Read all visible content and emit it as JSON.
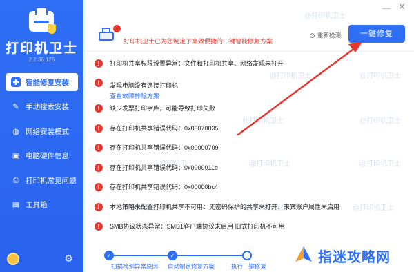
{
  "app": {
    "title": "打印机卫士",
    "version": "2.2.36.126"
  },
  "window": {
    "minimize_glyph": "—",
    "close_glyph": "✕"
  },
  "sidebar": {
    "items": [
      {
        "label": "智能修复安装",
        "icon": "shield-icon",
        "glyph": "⚙",
        "active": true
      },
      {
        "label": "手动搜索安装",
        "icon": "wrench-icon",
        "glyph": "🔧",
        "active": false
      },
      {
        "label": "网络安装模式",
        "icon": "globe-icon",
        "glyph": "◍",
        "active": false
      },
      {
        "label": "电脑硬件信息",
        "icon": "computer-icon",
        "glyph": "▣",
        "active": false
      },
      {
        "label": "打印机常见问题",
        "icon": "printer-icon",
        "glyph": "⎙",
        "active": false
      },
      {
        "label": "工具箱",
        "icon": "toolbox-icon",
        "glyph": "▤",
        "active": false
      }
    ],
    "settings_glyph": "⚙"
  },
  "header": {
    "message": "打印机卫士已为您制定了高效便捷的一键智能修复方案",
    "redetect_label": "重新检测",
    "fix_button_label": "一键修复"
  },
  "issues": [
    {
      "text": "打印机共享权限设置异常：文件和打印机共享、网络发现未打开"
    },
    {
      "text": "发现电脑没有连接打印机",
      "link": "查看故障排除方案"
    },
    {
      "text": "缺少发票打印字库，可能导致打印失败"
    },
    {
      "text": "存在打印机共享错误代码：0x80070035"
    },
    {
      "text": "存在打印机共享错误代码：0x00000709"
    },
    {
      "text": "存在打印机共享错误代码：0x0000011b"
    },
    {
      "text": "存在打印机共享错误代码：0x00000bc4"
    },
    {
      "text": "本地策略未配置打印机共享不可用：无密码保护的共享未打开、来宾账户属性未启用"
    },
    {
      "text": "SMB协议状态异常：SMB1客户端协议未启用 旧式打印机不可用"
    }
  ],
  "watermark": {
    "text": "@打印机卫士"
  },
  "steps": [
    {
      "label": "扫描检测异常原因",
      "state": "done"
    },
    {
      "label": "自动制定修复方案",
      "state": "done"
    },
    {
      "label": "执行一键修复",
      "state": "pending"
    }
  ],
  "brand": {
    "text": "指迷攻略网"
  },
  "colors": {
    "primary": "#2f6ff5",
    "error": "#e8362f",
    "arrow": "#e8362f"
  }
}
